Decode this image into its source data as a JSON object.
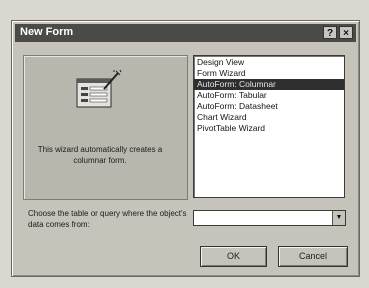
{
  "window": {
    "title": "New Form",
    "help_button": "?",
    "close_button": "×"
  },
  "preview": {
    "description": "This wizard automatically creates a columnar form."
  },
  "options": [
    {
      "label": "Design View",
      "selected": false
    },
    {
      "label": "Form Wizard",
      "selected": false
    },
    {
      "label": "AutoForm: Columnar",
      "selected": true
    },
    {
      "label": "AutoForm: Tabular",
      "selected": false
    },
    {
      "label": "AutoForm: Datasheet",
      "selected": false
    },
    {
      "label": "Chart Wizard",
      "selected": false
    },
    {
      "label": "PivotTable Wizard",
      "selected": false
    }
  ],
  "source": {
    "prompt": "Choose the table or query where the object's data comes from:",
    "value": ""
  },
  "buttons": {
    "ok": "OK",
    "cancel": "Cancel"
  }
}
